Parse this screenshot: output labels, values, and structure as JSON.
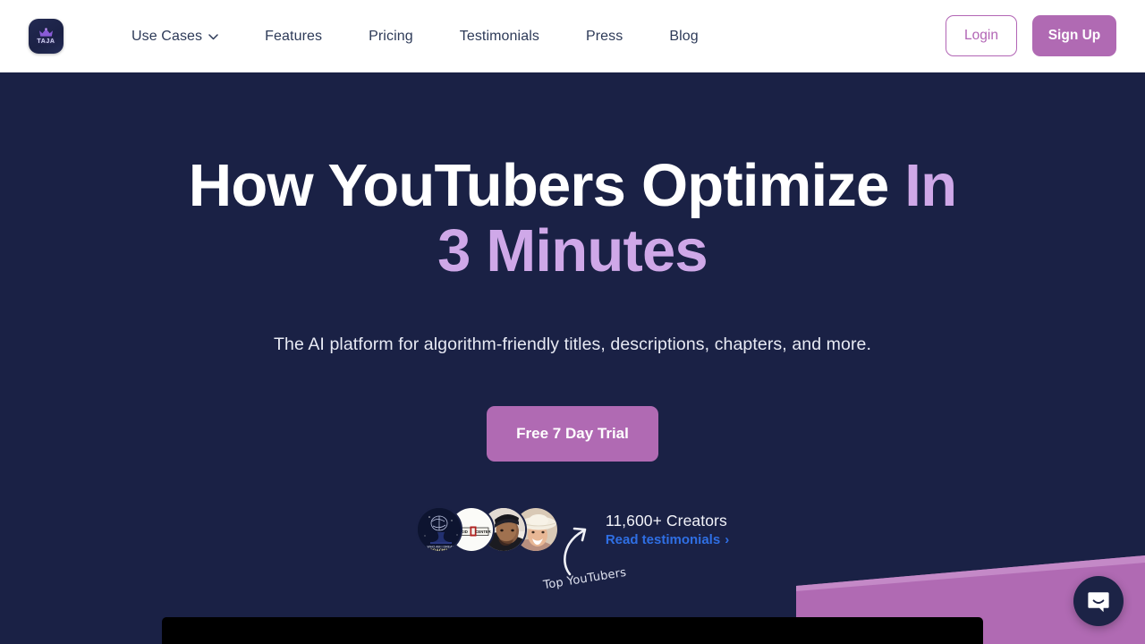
{
  "header": {
    "logo": {
      "brand": "TAJA",
      "icon": "crown-icon"
    },
    "nav": [
      {
        "label": "Use Cases",
        "has_dropdown": true
      },
      {
        "label": "Features",
        "has_dropdown": false
      },
      {
        "label": "Pricing",
        "has_dropdown": false
      },
      {
        "label": "Testimonials",
        "has_dropdown": false
      },
      {
        "label": "Press",
        "has_dropdown": false
      },
      {
        "label": "Blog",
        "has_dropdown": false
      }
    ],
    "login_label": "Login",
    "signup_label": "Sign Up"
  },
  "hero": {
    "headline_white": "How YouTubers Optimize ",
    "headline_accent": "In 3 Minutes",
    "subhead": "The AI platform for algorithm-friendly titles, descriptions, chapters, and more.",
    "cta_label": "Free 7 Day Trial",
    "social": {
      "creators": "11,600+ Creators",
      "testimonials_label": "Read testimonials",
      "testimonials_chevron": "›",
      "annotation": "Top YouTubers",
      "avatars": [
        {
          "name": "avatar-coaching-logo"
        },
        {
          "name": "avatar-center-logo"
        },
        {
          "name": "avatar-creator-man"
        },
        {
          "name": "avatar-creator-woman"
        }
      ]
    }
  },
  "chat": {
    "launcher_icon": "chat-bubble-smile-icon"
  },
  "colors": {
    "hero_bg": "#1a2145",
    "header_bg": "#ffffff",
    "accent_purple": "#b06ab3",
    "headline_accent": "#cfa8e8",
    "link_blue": "#2f6fe4",
    "nav_text": "#2d3a58"
  }
}
